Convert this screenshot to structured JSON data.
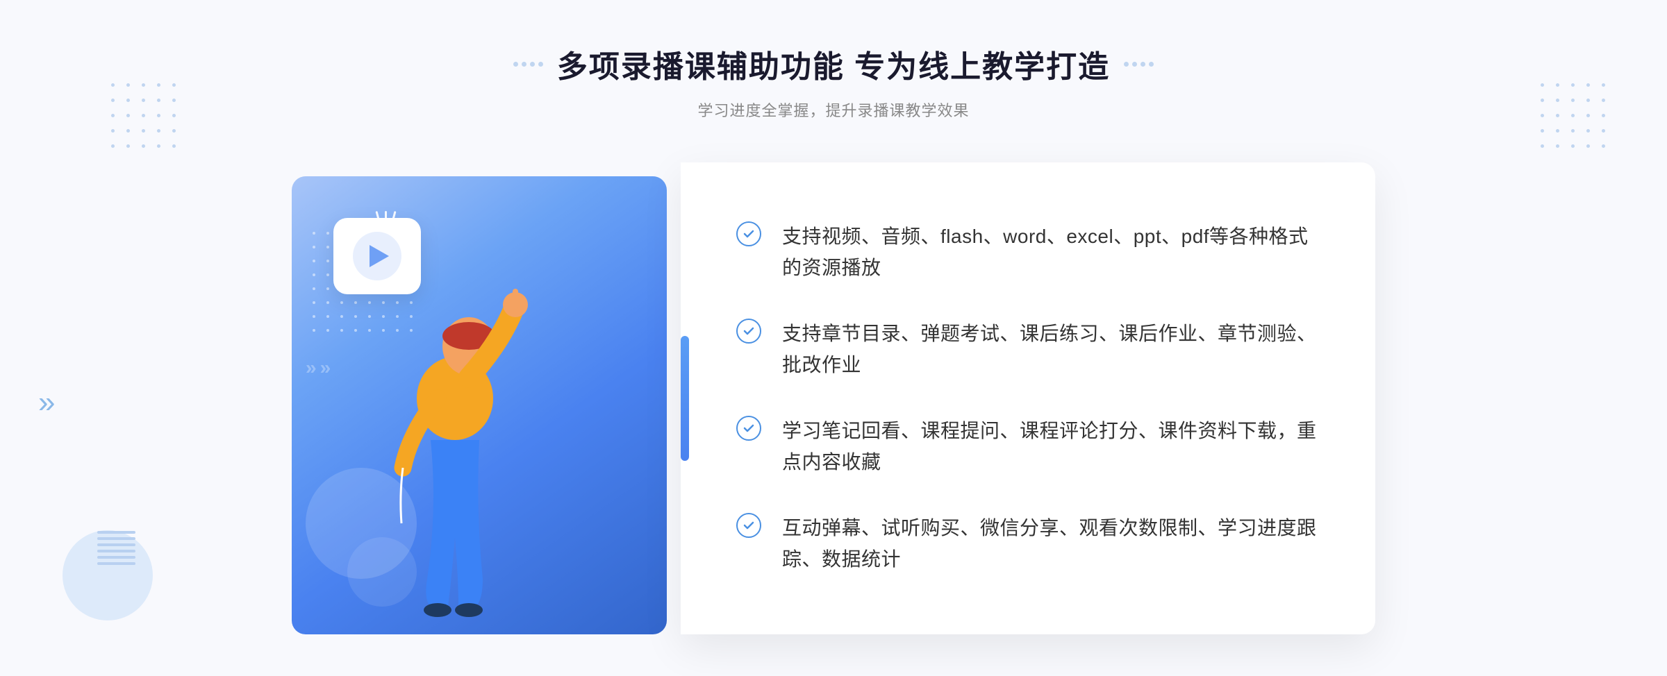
{
  "page": {
    "background_color": "#f5f7fd"
  },
  "header": {
    "title": "多项录播课辅助功能 专为线上教学打造",
    "subtitle": "学习进度全掌握，提升录播课教学效果"
  },
  "features": [
    {
      "id": 1,
      "text": "支持视频、音频、flash、word、excel、ppt、pdf等各种格式的资源播放"
    },
    {
      "id": 2,
      "text": "支持章节目录、弹题考试、课后练习、课后作业、章节测验、批改作业"
    },
    {
      "id": 3,
      "text": "学习笔记回看、课程提问、课程评论打分、课件资料下载，重点内容收藏"
    },
    {
      "id": 4,
      "text": "互动弹幕、试听购买、微信分享、观看次数限制、学习进度跟踪、数据统计"
    }
  ],
  "icons": {
    "check": "✓",
    "chevron_left": "《",
    "play": "▶"
  }
}
